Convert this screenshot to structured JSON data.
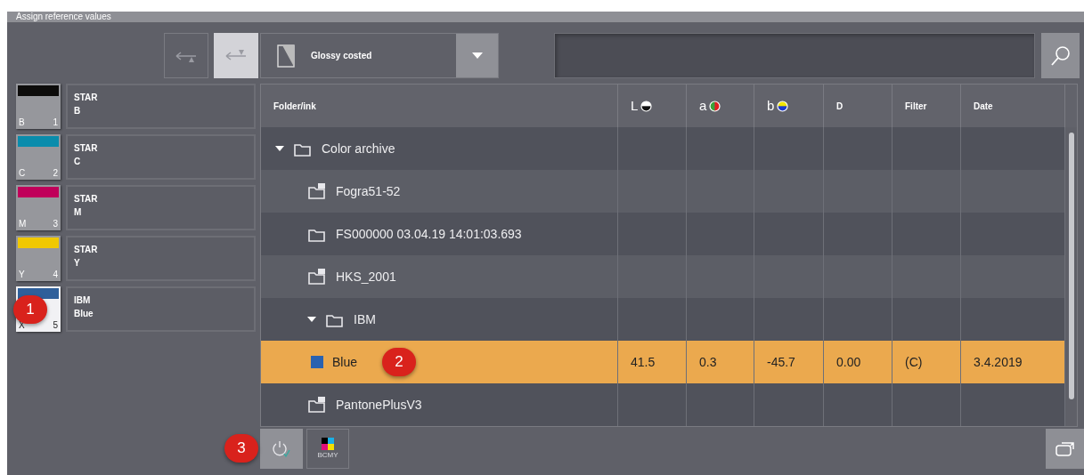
{
  "window": {
    "title": "Assign reference values"
  },
  "transfer_buttons": [
    {
      "kind": "up",
      "selected": false
    },
    {
      "kind": "down",
      "selected": true
    }
  ],
  "swatches": [
    {
      "color": "#0d0c0b",
      "letter": "B",
      "number": "1",
      "lines": [
        "STAR",
        "B"
      ],
      "selected": false
    },
    {
      "color": "#0a8cac",
      "letter": "C",
      "number": "2",
      "lines": [
        "STAR",
        "C"
      ],
      "selected": false
    },
    {
      "color": "#c0005a",
      "letter": "M",
      "number": "3",
      "lines": [
        "STAR",
        "M"
      ],
      "selected": false
    },
    {
      "color": "#f0c800",
      "letter": "Y",
      "number": "4",
      "lines": [
        "STAR",
        "Y"
      ],
      "selected": false
    },
    {
      "color": "#2f5f9a",
      "letter": "X",
      "number": "5",
      "lines": [
        "IBM",
        "Blue"
      ],
      "selected": true,
      "callout": "1"
    }
  ],
  "library_select": {
    "value": "Glossy costed"
  },
  "table": {
    "columns": [
      {
        "label": "Folder/ink"
      },
      {
        "label": "L",
        "kind": "lightness"
      },
      {
        "label": "a",
        "kind": "greenred"
      },
      {
        "label": "b",
        "kind": "yellowblue"
      },
      {
        "label": "D"
      },
      {
        "label": "Filter"
      },
      {
        "label": "Date"
      }
    ],
    "rows": [
      {
        "kind": "folder",
        "name": "Color archive",
        "expanded": true,
        "children": [
          {
            "kind": "library",
            "name": "Fogra51-52"
          },
          {
            "kind": "folder",
            "name": "FS000000 03.04.19 14:01:03.693"
          },
          {
            "kind": "library",
            "name": "HKS_2001"
          },
          {
            "kind": "folder",
            "name": "IBM",
            "expanded": true,
            "children": [
              {
                "kind": "ink",
                "name": "Blue",
                "color": "#2a62b0",
                "selected": true,
                "callout": "2",
                "values": [
                  "41.5",
                  "0.3",
                  "-45.7",
                  "0.00",
                  "(C)",
                  "3.4.2019"
                ]
              }
            ]
          },
          {
            "kind": "library",
            "name": "PantonePlusV3"
          }
        ]
      }
    ]
  },
  "bottom_buttons": [
    {
      "kind": "power",
      "selected": true,
      "callout": "3"
    },
    {
      "kind": "bcmy",
      "label": "BCMY",
      "selected": false
    }
  ]
}
